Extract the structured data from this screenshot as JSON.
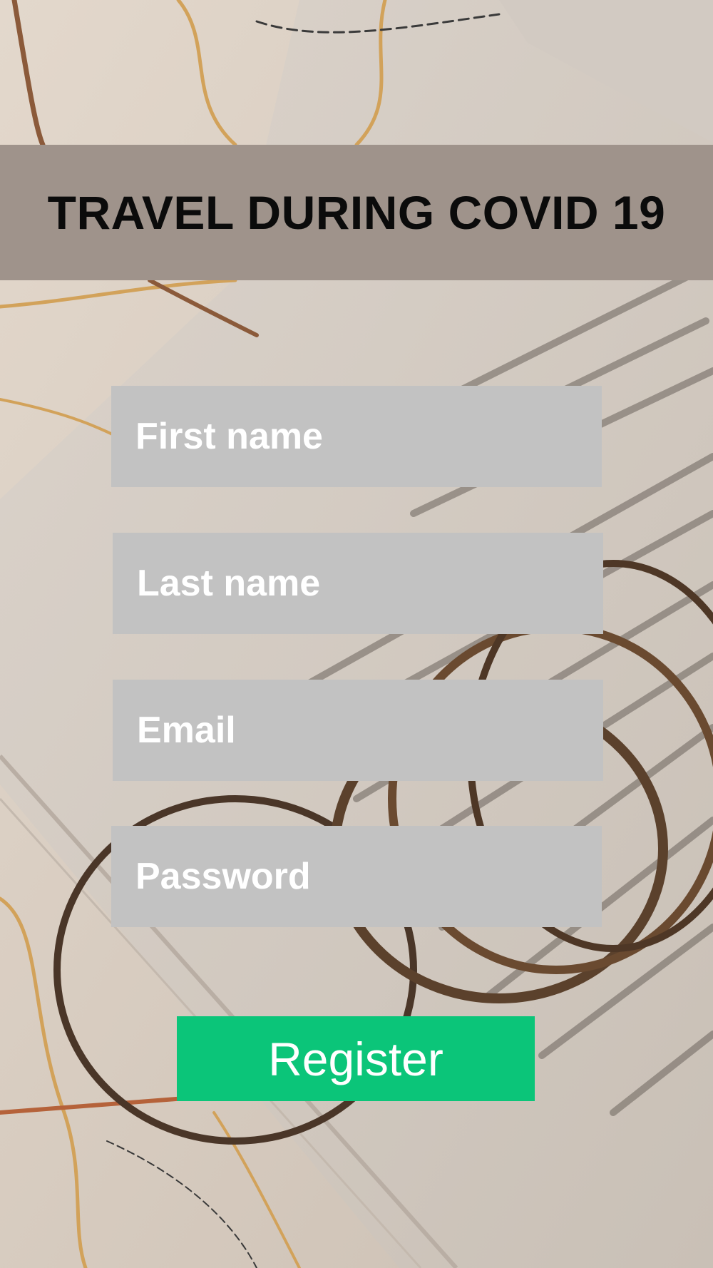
{
  "header": {
    "title": "TRAVEL DURING COVID 19"
  },
  "form": {
    "first_name_placeholder": "First name",
    "last_name_placeholder": "Last name",
    "email_placeholder": "Email",
    "password_placeholder": "Password",
    "register_label": "Register"
  },
  "colors": {
    "header_band": "#9f938b",
    "field_background": "#c2c2c2",
    "register_button": "#0bc579",
    "title_text": "#0b0b0b"
  }
}
